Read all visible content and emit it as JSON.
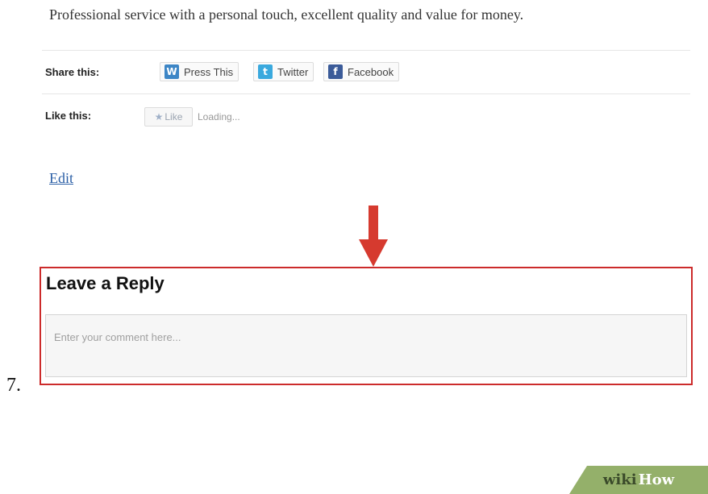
{
  "post": {
    "intro_text": "Professional service with a personal touch, excellent quality and value for money."
  },
  "share": {
    "label": "Share this:",
    "buttons": [
      {
        "label": "Press This",
        "icon": "wordpress-icon",
        "color": "#3d86c6"
      },
      {
        "label": "Twitter",
        "icon": "twitter-icon",
        "color": "#3aa9de"
      },
      {
        "label": "Facebook",
        "icon": "facebook-icon",
        "color": "#3b5b99"
      }
    ]
  },
  "like": {
    "label": "Like this:",
    "button_label": "Like",
    "status": "Loading..."
  },
  "edit_link": "Edit",
  "reply": {
    "title": "Leave a Reply",
    "placeholder": "Enter your comment here..."
  },
  "step": {
    "number": "7."
  },
  "watermark": {
    "part1": "wiki",
    "part2": "How"
  },
  "colors": {
    "highlight": "#cc2b2b",
    "link": "#2b5fa6",
    "watermark_bg": "#94b06a"
  }
}
